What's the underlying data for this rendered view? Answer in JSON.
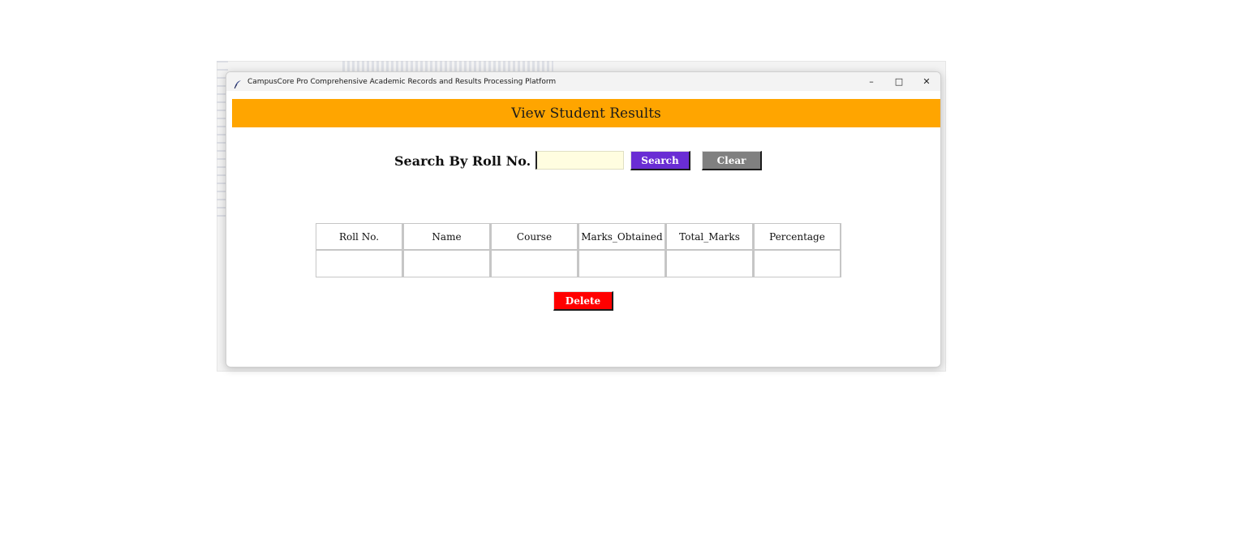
{
  "window": {
    "title": "CampusCore Pro Comprehensive Academic Records and Results Processing Platform",
    "controls": {
      "minimize": "–",
      "maximize": "□",
      "close": "✕"
    }
  },
  "header": {
    "title": "View Student Results",
    "color": "#ffa500"
  },
  "search": {
    "label": "Search By Roll No.",
    "input_value": "",
    "search_button": "Search",
    "clear_button": "Clear"
  },
  "table": {
    "columns": [
      "Roll No.",
      "Name",
      "Course",
      "Marks_Obtained",
      "Total_Marks",
      "Percentage"
    ],
    "rows": [
      [
        "",
        "",
        "",
        "",
        "",
        ""
      ]
    ]
  },
  "actions": {
    "delete_button": "Delete"
  },
  "colors": {
    "search_button": "#6a2dd4",
    "clear_button": "#808080",
    "delete_button": "#ff0000",
    "input_bg": "#fffde0"
  }
}
